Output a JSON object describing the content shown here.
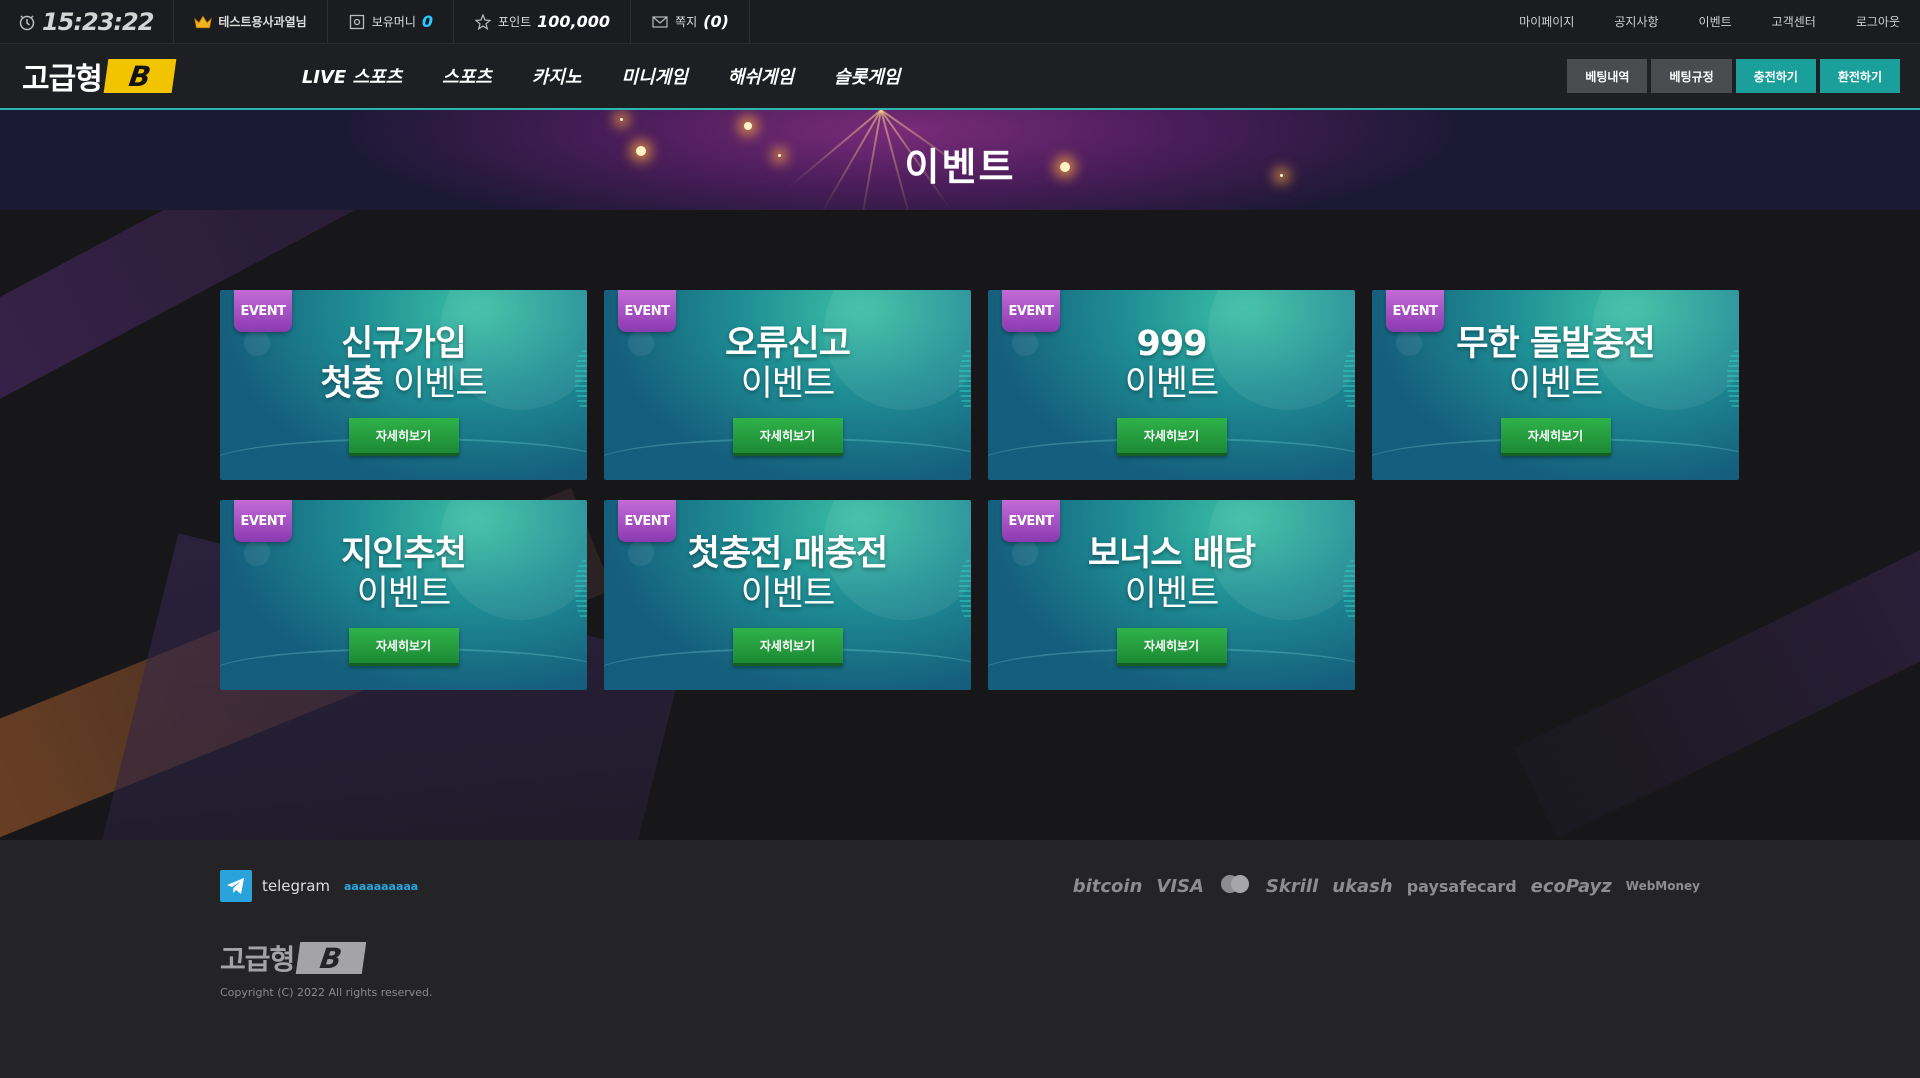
{
  "topbar": {
    "time": "15:23:22",
    "username": "테스트용사과열님",
    "money_label": "보유머니",
    "money_value": "0",
    "point_label": "포인트",
    "point_value": "100,000",
    "message_label": "쪽지",
    "message_value": "(0)",
    "links": [
      "마이페이지",
      "공지사항",
      "이벤트",
      "고객센터",
      "로그아웃"
    ]
  },
  "nav": {
    "logo_text": "고급형",
    "logo_badge": "B",
    "menu": [
      "LIVE 스포츠",
      "스포츠",
      "카지노",
      "미니게임",
      "해쉬게임",
      "슬롯게임"
    ],
    "buttons": [
      "베팅내역",
      "베팅규정",
      "충전하기",
      "환전하기"
    ]
  },
  "hero": {
    "title": "이벤트"
  },
  "events": [
    {
      "badge": "EVENT",
      "title_bold": "신규가입",
      "title_line2_bold": "첫충",
      "title_line2_sub": " 이벤트",
      "button": "자세히보기"
    },
    {
      "badge": "EVENT",
      "title_bold": "오류신고",
      "title_line2_bold": "",
      "title_line2_sub": "이벤트",
      "button": "자세히보기"
    },
    {
      "badge": "EVENT",
      "title_bold": "999",
      "title_line2_bold": "",
      "title_line2_sub": "이벤트",
      "button": "자세히보기"
    },
    {
      "badge": "EVENT",
      "title_bold": "무한 돌발충전",
      "title_line2_bold": "",
      "title_line2_sub": "이벤트",
      "button": "자세히보기"
    },
    {
      "badge": "EVENT",
      "title_bold": "지인추천",
      "title_line2_bold": "",
      "title_line2_sub": "이벤트",
      "button": "자세히보기"
    },
    {
      "badge": "EVENT",
      "title_bold": "첫충전,매충전",
      "title_line2_bold": "",
      "title_line2_sub": "이벤트",
      "button": "자세히보기"
    },
    {
      "badge": "EVENT",
      "title_bold": "보너스 배당",
      "title_line2_bold": "",
      "title_line2_sub": "이벤트",
      "button": "자세히보기"
    }
  ],
  "footer": {
    "telegram_label": "telegram",
    "telegram_id": "aaaaaaaaaa",
    "payments": [
      "bitcoin",
      "VISA",
      "Skrill",
      "ukash",
      "paysafecard",
      "ecoPayz",
      "WebMoney"
    ],
    "logo_text": "고급형",
    "logo_badge": "B",
    "copyright": "Copyright (C) 2022 All rights reserved."
  }
}
